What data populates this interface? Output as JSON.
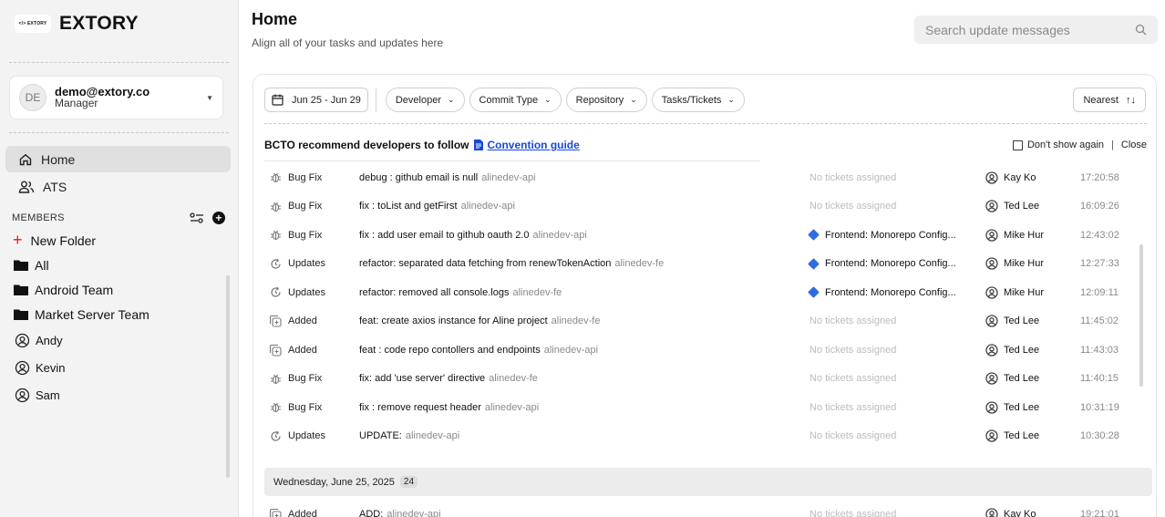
{
  "brand": {
    "logo_text": "</> EXTORY",
    "name": "EXTORY"
  },
  "user": {
    "initials": "DE",
    "email": "demo@extory.co",
    "role": "Manager"
  },
  "nav": [
    {
      "label": "Home",
      "icon": "home-icon",
      "active": true
    },
    {
      "label": "ATS",
      "icon": "users-icon",
      "active": false
    }
  ],
  "members": {
    "heading": "MEMBERS",
    "new_folder": "New Folder",
    "folders": [
      "All",
      "Android Team",
      "Market Server Team"
    ],
    "people": [
      "Andy",
      "Kevin",
      "Sam"
    ]
  },
  "header": {
    "title": "Home",
    "subtitle": "Align all of your tasks and updates here",
    "search_placeholder": "Search update messages"
  },
  "filters": {
    "date_range": "Jun 25 - Jun 29",
    "chips": [
      "Developer",
      "Commit Type",
      "Repository",
      "Tasks/Tickets"
    ],
    "sort": "Nearest"
  },
  "recommendation": {
    "text": "BCTO recommend developers to follow",
    "link": "Convention guide",
    "dont_show": "Don't show again",
    "close": "Close"
  },
  "updates": [
    {
      "type": "Bug Fix",
      "icon": "bug-icon",
      "message": "debug : github email is null",
      "repo": "alinedev-api",
      "ticket": "No tickets assigned",
      "has_ticket": false,
      "user": "Kay Ko",
      "time": "17:20:58"
    },
    {
      "type": "Bug Fix",
      "icon": "bug-icon",
      "message": "fix : toList and getFirst",
      "repo": "alinedev-api",
      "ticket": "No tickets assigned",
      "has_ticket": false,
      "user": "Ted Lee",
      "time": "16:09:26"
    },
    {
      "type": "Bug Fix",
      "icon": "bug-icon",
      "message": "fix : add user email to github oauth 2.0",
      "repo": "alinedev-api",
      "ticket": "Frontend: Monorepo Config...",
      "has_ticket": true,
      "user": "Mike Hur",
      "time": "12:43:02"
    },
    {
      "type": "Updates",
      "icon": "refresh-icon",
      "message": "refactor: separated data fetching from renewTokenAction",
      "repo": "alinedev-fe",
      "ticket": "Frontend: Monorepo Config...",
      "has_ticket": true,
      "user": "Mike Hur",
      "time": "12:27:33"
    },
    {
      "type": "Updates",
      "icon": "refresh-icon",
      "message": "refactor: removed all console.logs",
      "repo": "alinedev-fe",
      "ticket": "Frontend: Monorepo Config...",
      "has_ticket": true,
      "user": "Mike Hur",
      "time": "12:09:11"
    },
    {
      "type": "Added",
      "icon": "add-copy-icon",
      "message": "feat: create axios instance for Aline project",
      "repo": "alinedev-fe",
      "ticket": "No tickets assigned",
      "has_ticket": false,
      "user": "Ted Lee",
      "time": "11:45:02"
    },
    {
      "type": "Added",
      "icon": "add-copy-icon",
      "message": "feat : code repo contollers and endpoints",
      "repo": "alinedev-api",
      "ticket": "No tickets assigned",
      "has_ticket": false,
      "user": "Ted Lee",
      "time": "11:43:03"
    },
    {
      "type": "Bug Fix",
      "icon": "bug-icon",
      "message": "fix: add 'use server' directive",
      "repo": "alinedev-fe",
      "ticket": "No tickets assigned",
      "has_ticket": false,
      "user": "Ted Lee",
      "time": "11:40:15"
    },
    {
      "type": "Bug Fix",
      "icon": "bug-icon",
      "message": "fix : remove request header",
      "repo": "alinedev-api",
      "ticket": "No tickets assigned",
      "has_ticket": false,
      "user": "Ted Lee",
      "time": "10:31:19"
    },
    {
      "type": "Updates",
      "icon": "refresh-icon",
      "message": "UPDATE:",
      "repo": "alinedev-api",
      "ticket": "No tickets assigned",
      "has_ticket": false,
      "user": "Ted Lee",
      "time": "10:30:28"
    }
  ],
  "date_group": {
    "label": "Wednesday, June 25, 2025",
    "count": "24"
  },
  "updates_group2": [
    {
      "type": "Added",
      "icon": "add-copy-icon",
      "message": "ADD:",
      "repo": "alinedev-api",
      "ticket": "No tickets assigned",
      "has_ticket": false,
      "user": "Kay Ko",
      "time": "19:21:01"
    }
  ],
  "colors": {
    "link": "#1a49d6",
    "ticket_diamond": "#2f6ce0",
    "new_folder_plus": "#e02020",
    "sidebar_bg": "#f3f3f3"
  }
}
